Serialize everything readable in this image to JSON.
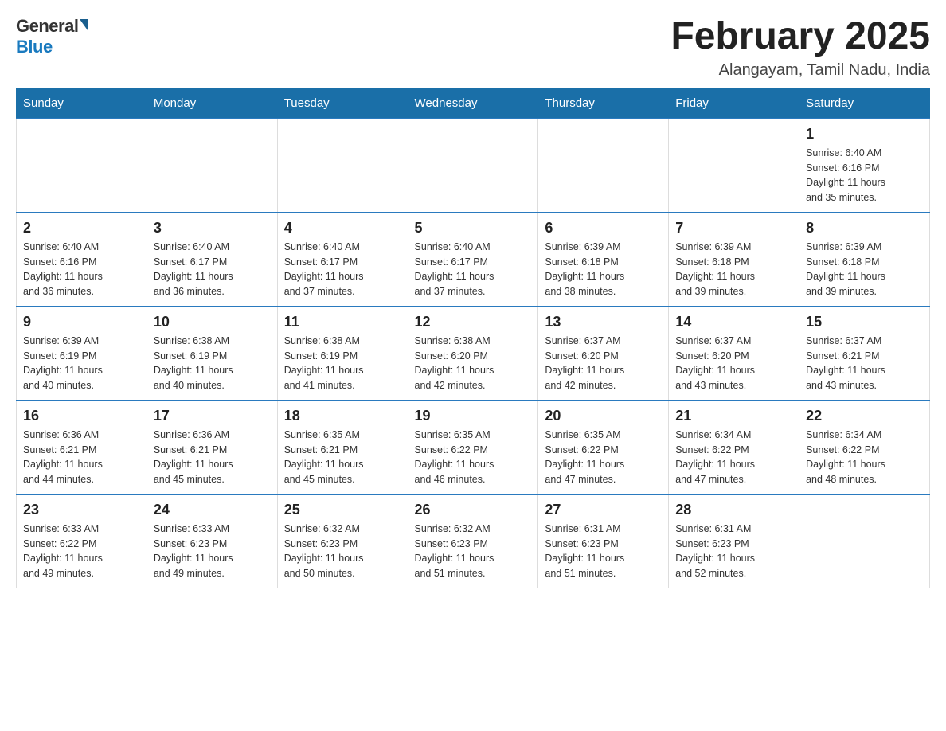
{
  "header": {
    "logo_general": "General",
    "logo_blue": "Blue",
    "month_title": "February 2025",
    "location": "Alangayam, Tamil Nadu, India"
  },
  "days_of_week": [
    "Sunday",
    "Monday",
    "Tuesday",
    "Wednesday",
    "Thursday",
    "Friday",
    "Saturday"
  ],
  "weeks": [
    [
      {
        "day": "",
        "info": ""
      },
      {
        "day": "",
        "info": ""
      },
      {
        "day": "",
        "info": ""
      },
      {
        "day": "",
        "info": ""
      },
      {
        "day": "",
        "info": ""
      },
      {
        "day": "",
        "info": ""
      },
      {
        "day": "1",
        "info": "Sunrise: 6:40 AM\nSunset: 6:16 PM\nDaylight: 11 hours\nand 35 minutes."
      }
    ],
    [
      {
        "day": "2",
        "info": "Sunrise: 6:40 AM\nSunset: 6:16 PM\nDaylight: 11 hours\nand 36 minutes."
      },
      {
        "day": "3",
        "info": "Sunrise: 6:40 AM\nSunset: 6:17 PM\nDaylight: 11 hours\nand 36 minutes."
      },
      {
        "day": "4",
        "info": "Sunrise: 6:40 AM\nSunset: 6:17 PM\nDaylight: 11 hours\nand 37 minutes."
      },
      {
        "day": "5",
        "info": "Sunrise: 6:40 AM\nSunset: 6:17 PM\nDaylight: 11 hours\nand 37 minutes."
      },
      {
        "day": "6",
        "info": "Sunrise: 6:39 AM\nSunset: 6:18 PM\nDaylight: 11 hours\nand 38 minutes."
      },
      {
        "day": "7",
        "info": "Sunrise: 6:39 AM\nSunset: 6:18 PM\nDaylight: 11 hours\nand 39 minutes."
      },
      {
        "day": "8",
        "info": "Sunrise: 6:39 AM\nSunset: 6:18 PM\nDaylight: 11 hours\nand 39 minutes."
      }
    ],
    [
      {
        "day": "9",
        "info": "Sunrise: 6:39 AM\nSunset: 6:19 PM\nDaylight: 11 hours\nand 40 minutes."
      },
      {
        "day": "10",
        "info": "Sunrise: 6:38 AM\nSunset: 6:19 PM\nDaylight: 11 hours\nand 40 minutes."
      },
      {
        "day": "11",
        "info": "Sunrise: 6:38 AM\nSunset: 6:19 PM\nDaylight: 11 hours\nand 41 minutes."
      },
      {
        "day": "12",
        "info": "Sunrise: 6:38 AM\nSunset: 6:20 PM\nDaylight: 11 hours\nand 42 minutes."
      },
      {
        "day": "13",
        "info": "Sunrise: 6:37 AM\nSunset: 6:20 PM\nDaylight: 11 hours\nand 42 minutes."
      },
      {
        "day": "14",
        "info": "Sunrise: 6:37 AM\nSunset: 6:20 PM\nDaylight: 11 hours\nand 43 minutes."
      },
      {
        "day": "15",
        "info": "Sunrise: 6:37 AM\nSunset: 6:21 PM\nDaylight: 11 hours\nand 43 minutes."
      }
    ],
    [
      {
        "day": "16",
        "info": "Sunrise: 6:36 AM\nSunset: 6:21 PM\nDaylight: 11 hours\nand 44 minutes."
      },
      {
        "day": "17",
        "info": "Sunrise: 6:36 AM\nSunset: 6:21 PM\nDaylight: 11 hours\nand 45 minutes."
      },
      {
        "day": "18",
        "info": "Sunrise: 6:35 AM\nSunset: 6:21 PM\nDaylight: 11 hours\nand 45 minutes."
      },
      {
        "day": "19",
        "info": "Sunrise: 6:35 AM\nSunset: 6:22 PM\nDaylight: 11 hours\nand 46 minutes."
      },
      {
        "day": "20",
        "info": "Sunrise: 6:35 AM\nSunset: 6:22 PM\nDaylight: 11 hours\nand 47 minutes."
      },
      {
        "day": "21",
        "info": "Sunrise: 6:34 AM\nSunset: 6:22 PM\nDaylight: 11 hours\nand 47 minutes."
      },
      {
        "day": "22",
        "info": "Sunrise: 6:34 AM\nSunset: 6:22 PM\nDaylight: 11 hours\nand 48 minutes."
      }
    ],
    [
      {
        "day": "23",
        "info": "Sunrise: 6:33 AM\nSunset: 6:22 PM\nDaylight: 11 hours\nand 49 minutes."
      },
      {
        "day": "24",
        "info": "Sunrise: 6:33 AM\nSunset: 6:23 PM\nDaylight: 11 hours\nand 49 minutes."
      },
      {
        "day": "25",
        "info": "Sunrise: 6:32 AM\nSunset: 6:23 PM\nDaylight: 11 hours\nand 50 minutes."
      },
      {
        "day": "26",
        "info": "Sunrise: 6:32 AM\nSunset: 6:23 PM\nDaylight: 11 hours\nand 51 minutes."
      },
      {
        "day": "27",
        "info": "Sunrise: 6:31 AM\nSunset: 6:23 PM\nDaylight: 11 hours\nand 51 minutes."
      },
      {
        "day": "28",
        "info": "Sunrise: 6:31 AM\nSunset: 6:23 PM\nDaylight: 11 hours\nand 52 minutes."
      },
      {
        "day": "",
        "info": ""
      }
    ]
  ]
}
